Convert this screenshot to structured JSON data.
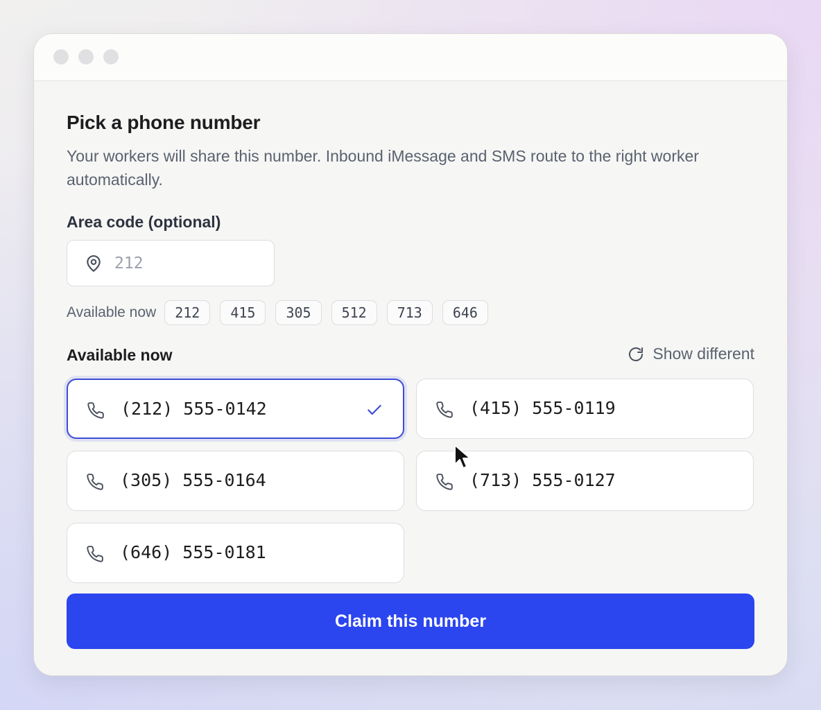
{
  "dialog": {
    "title": "Pick a phone number",
    "subtitle": "Your workers will share this number. Inbound iMessage and SMS route to the right worker automatically."
  },
  "area_code": {
    "label": "Area code (optional)",
    "placeholder": "212",
    "value": "",
    "quick_label": "Available now",
    "quick_codes": [
      "212",
      "415",
      "305",
      "512",
      "713",
      "646"
    ]
  },
  "numbers_section": {
    "label": "Available now",
    "refresh_label": "Show different",
    "numbers": [
      {
        "number": "(212) 555-0142",
        "selected": true
      },
      {
        "number": "(415) 555-0119",
        "selected": false
      },
      {
        "number": "(305) 555-0164",
        "selected": false
      },
      {
        "number": "(713) 555-0127",
        "selected": false
      },
      {
        "number": "(646) 555-0181",
        "selected": false
      }
    ]
  },
  "actions": {
    "claim_label": "Claim this number"
  },
  "icons": {
    "area_input": "location-pin-icon",
    "refresh": "refresh-icon",
    "number": "phone-icon",
    "selected": "checkmark-icon"
  },
  "colors": {
    "primary": "#2b45ef",
    "selected_border": "#3b4bd8",
    "text": "#1d1d1f",
    "muted_text": "#5a6270"
  }
}
